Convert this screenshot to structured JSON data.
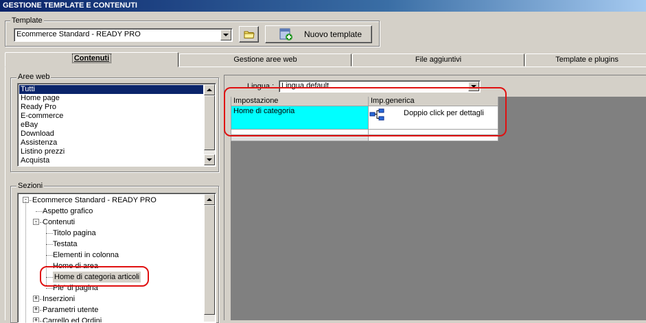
{
  "window": {
    "title": "GESTIONE TEMPLATE E CONTENUTI"
  },
  "template_group": {
    "label": "Template",
    "selected": "Ecommerce Standard - READY PRO",
    "new_button_label": "Nuovo template"
  },
  "tabs": [
    {
      "label": "Contenuti",
      "active": true
    },
    {
      "label": "Gestione aree web",
      "active": false
    },
    {
      "label": "File aggiuntivi",
      "active": false
    },
    {
      "label": "Template e plugins",
      "active": false
    }
  ],
  "aree_web": {
    "label": "Aree web",
    "items": [
      "Tutti",
      "Home page",
      "Ready Pro",
      "E-commerce",
      "eBay",
      "Download",
      "Assistenza",
      "Listino prezzi",
      "Acquista"
    ],
    "selected_index": 0
  },
  "sezioni": {
    "label": "Sezioni",
    "tree": [
      {
        "label": "Ecommerce Standard - READY PRO",
        "level": 0,
        "expander": "-"
      },
      {
        "label": "Aspetto grafico",
        "level": 1,
        "expander": ""
      },
      {
        "label": "Contenuti",
        "level": 1,
        "expander": "-"
      },
      {
        "label": "Titolo pagina",
        "level": 2,
        "expander": ""
      },
      {
        "label": "Testata",
        "level": 2,
        "expander": ""
      },
      {
        "label": "Elementi in colonna",
        "level": 2,
        "expander": ""
      },
      {
        "label": "Home di area",
        "level": 2,
        "expander": ""
      },
      {
        "label": "Home di categoria articoli",
        "level": 2,
        "expander": "",
        "selected": true
      },
      {
        "label": "Pie' di pagina",
        "level": 2,
        "expander": ""
      },
      {
        "label": "Inserzioni",
        "level": 1,
        "expander": "+"
      },
      {
        "label": "Parametri utente",
        "level": 1,
        "expander": "+"
      },
      {
        "label": "Carrello ed Ordini",
        "level": 1,
        "expander": "+"
      }
    ]
  },
  "lingua": {
    "label": "Lingua :",
    "selected": "Lingua default"
  },
  "grid": {
    "columns": [
      "Impostazione",
      "Imp.generica"
    ],
    "rows": [
      {
        "impostazione": "Home di categoria",
        "generica": "Doppio click per dettagli"
      }
    ]
  },
  "colors": {
    "title_bar": "#0a246a",
    "highlight_cell": "#00ffff",
    "annotation": "#e01010",
    "grid_bg": "#808080"
  }
}
